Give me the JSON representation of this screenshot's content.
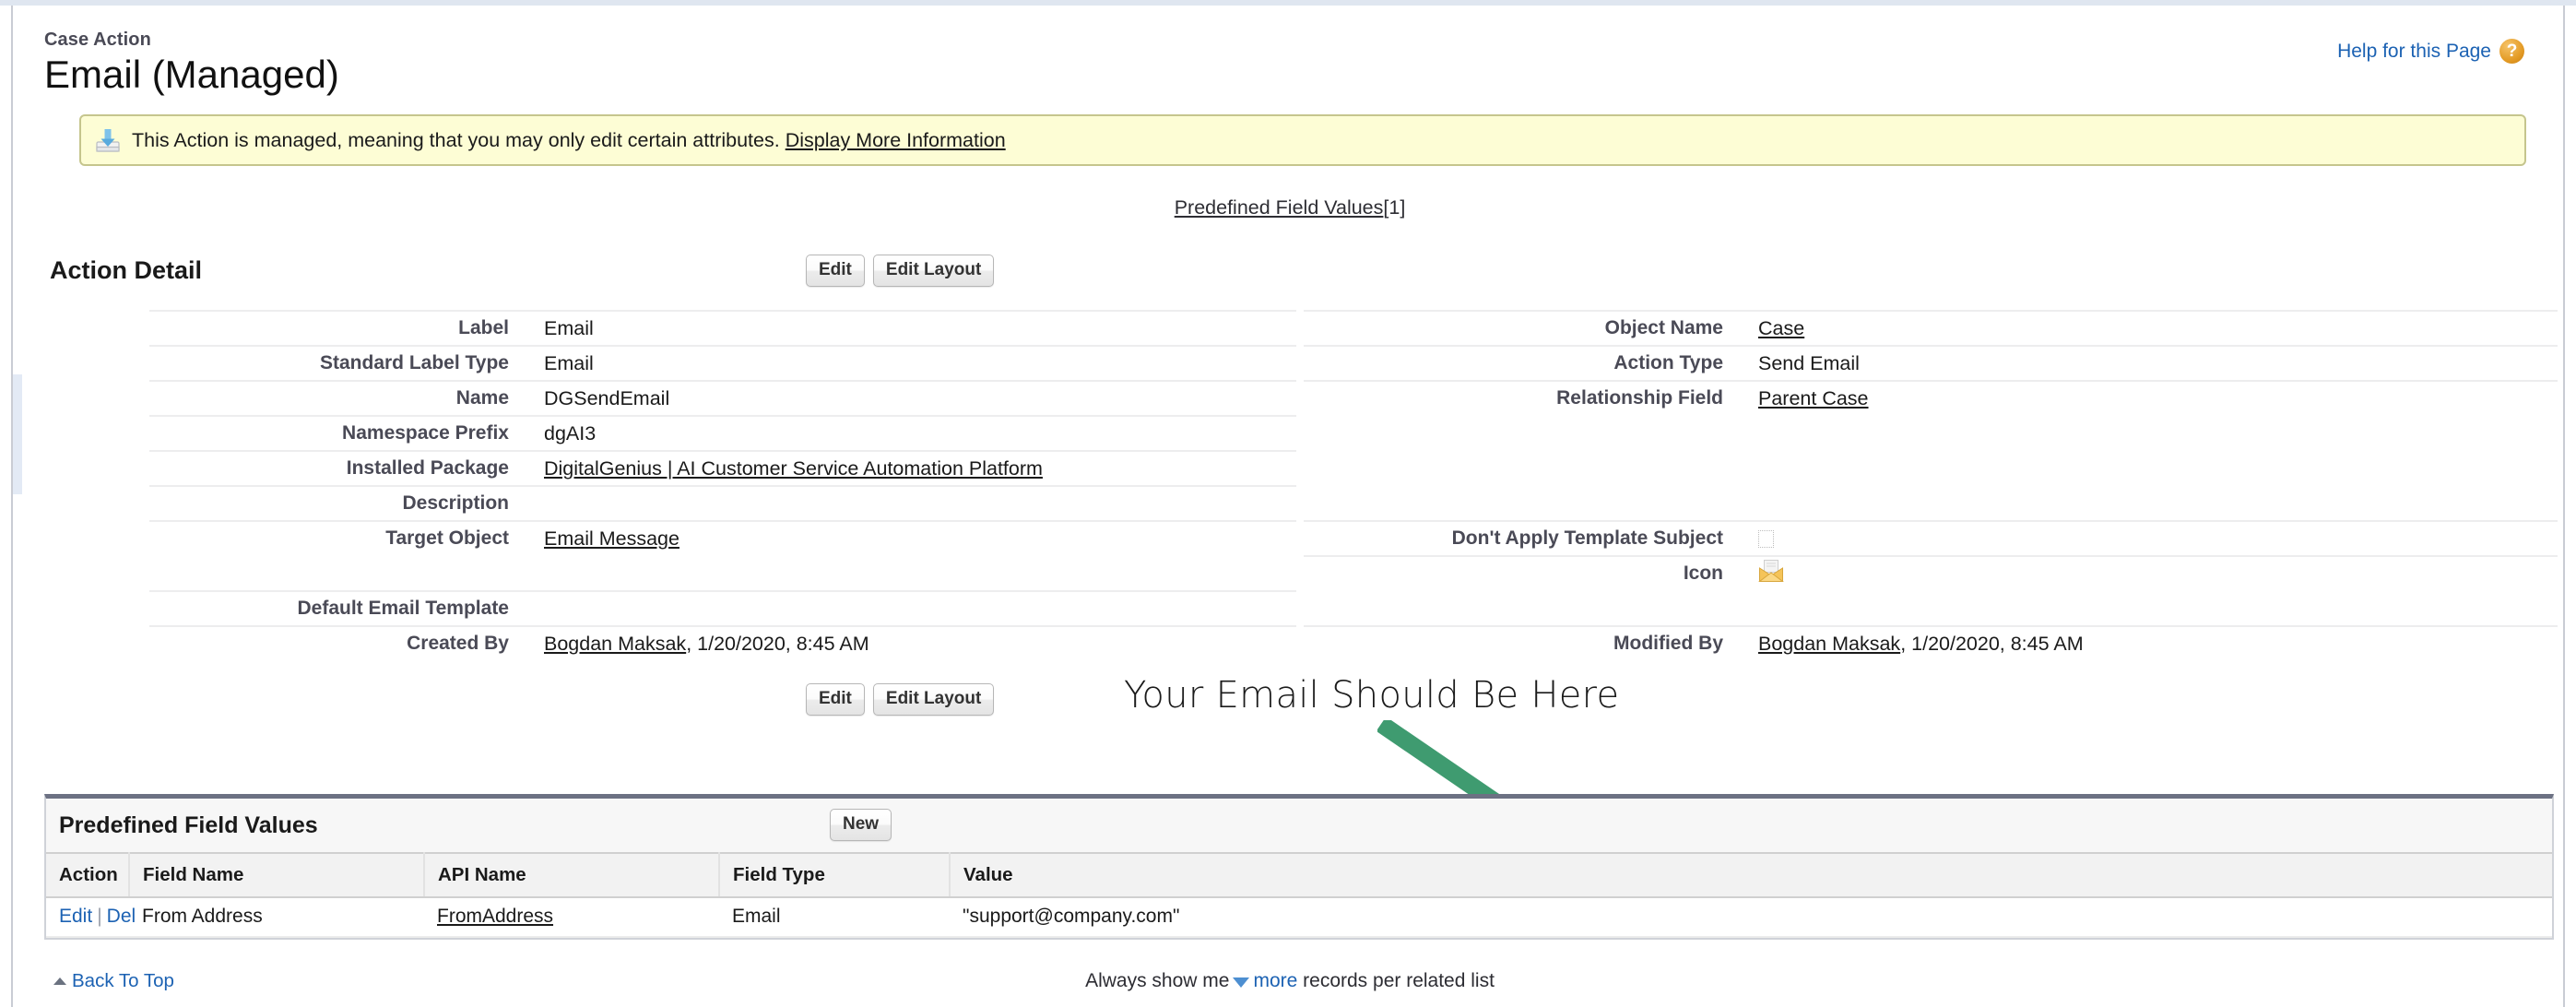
{
  "header": {
    "eyebrow": "Case Action",
    "title": "Email (Managed)",
    "help_label": "Help for this Page",
    "help_icon_glyph": "?"
  },
  "banner": {
    "icon": "package-install-icon",
    "text_before": "This Action is managed, meaning that you may only edit certain attributes.",
    "link_label": "Display More Information"
  },
  "jump": {
    "link_label": "Predefined Field Values",
    "count": "[1]"
  },
  "action_detail": {
    "section_title": "Action Detail",
    "edit_label": "Edit",
    "edit_layout_label": "Edit Layout",
    "left_fields": [
      {
        "label": "Label",
        "value": "Email",
        "link": false
      },
      {
        "label": "Standard Label Type",
        "value": "Email",
        "link": false
      },
      {
        "label": "Name",
        "value": "DGSendEmail",
        "link": false
      },
      {
        "label": "Namespace Prefix",
        "value": "dgAI3",
        "link": false
      },
      {
        "label": "Installed Package",
        "value": "DigitalGenius | AI Customer Service Automation Platform",
        "link": true
      },
      {
        "label": "Description",
        "value": "",
        "link": false
      },
      {
        "label": "Target Object",
        "value": "Email Message",
        "link": true
      },
      {
        "label": "",
        "value": "",
        "link": false
      },
      {
        "label": "Default Email Template",
        "value": "",
        "link": false
      },
      {
        "label": "Created By",
        "value": "Bogdan Maksak",
        "suffix": ", 1/20/2020, 8:45 AM",
        "link": true
      }
    ],
    "right_fields": [
      {
        "label": "Object Name",
        "value": "Case",
        "link": true
      },
      {
        "label": "Action Type",
        "value": "Send Email",
        "link": false
      },
      {
        "label": "Relationship Field",
        "value": "Parent Case",
        "link": true
      },
      {
        "label": "",
        "value": "",
        "link": false
      },
      {
        "label": "",
        "value": "",
        "link": false
      },
      {
        "label": "",
        "value": "",
        "link": false
      },
      {
        "label": "Don't Apply Template Subject",
        "value": "",
        "kind": "checkbox",
        "checked": false
      },
      {
        "label": "Icon",
        "value": "",
        "kind": "icon",
        "icon": "open-envelope-icon"
      },
      {
        "label": "",
        "value": "",
        "link": false
      },
      {
        "label": "Modified By",
        "value": "Bogdan Maksak",
        "suffix": ", 1/20/2020, 8:45 AM",
        "link": true
      }
    ]
  },
  "annotation": {
    "text": "Your Email Should Be Here",
    "arrow_color": "#3f9b70"
  },
  "related_list": {
    "title": "Predefined Field Values",
    "new_label": "New",
    "columns": [
      "Action",
      "Field Name",
      "API Name",
      "Field Type",
      "Value"
    ],
    "rows": [
      {
        "edit_label": "Edit",
        "del_label": "Del",
        "field_name": "From Address",
        "api_name": "FromAddress",
        "field_type": "Email",
        "value": "\"support@company.com\""
      }
    ]
  },
  "footer": {
    "back_to_top": "Back To Top",
    "always_show_prefix": "Always show me",
    "more_label": "more",
    "always_show_suffix": "records per related list"
  }
}
